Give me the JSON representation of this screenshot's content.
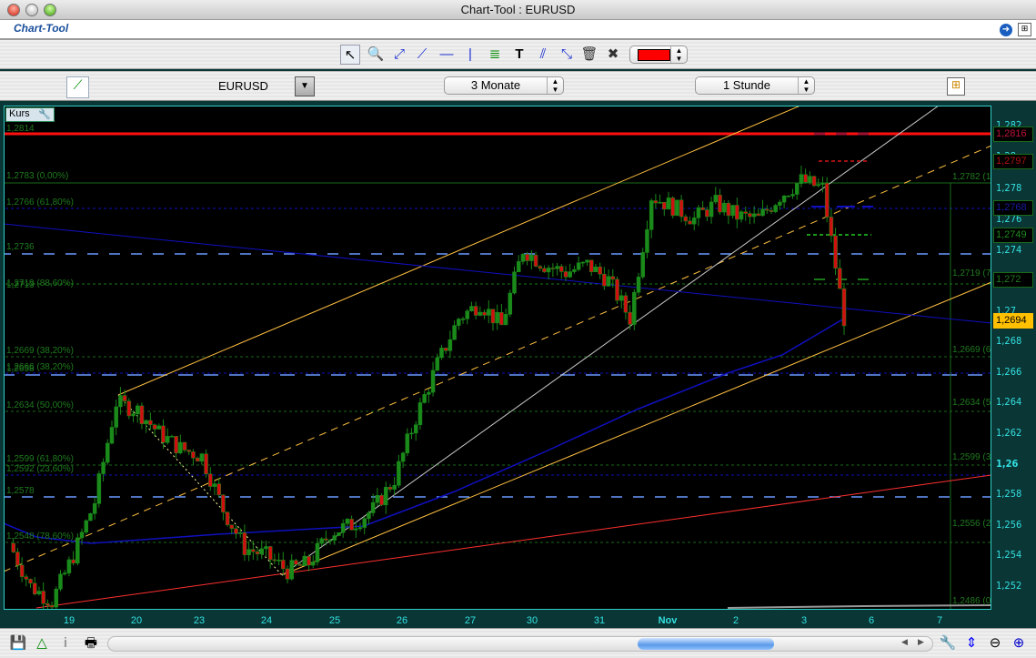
{
  "window": {
    "title": "Chart-Tool : EURUSD",
    "app_name": "Chart-Tool"
  },
  "toolbar": {
    "tools": [
      "pointer-icon",
      "zoom-icon",
      "segment-icon",
      "line-icon",
      "horizontal-line-icon",
      "vertical-line-icon",
      "fibonacci-icon",
      "text-icon",
      "parallel-lines-icon",
      "arrows-icon",
      "trash-icon",
      "tools-icon"
    ],
    "color": "#ff0000"
  },
  "selector": {
    "symbol": "EURUSD",
    "period": "3 Monate",
    "interval": "1 Stunde"
  },
  "chart": {
    "panel_label": "Kurs",
    "left_labels": [
      "1,2814",
      "1,2783 (0,00%)",
      "1,2766 (61,80%)",
      "1,2736",
      "1,2719 (88,60%)",
      "1,2713",
      "1,2669 (38,20%)",
      "1,2666 (38,20%)",
      "1,2658",
      "1,2634 (50,00%)",
      "1,2599 (61,80%)",
      "1,2592 (23,60%)",
      "1,2578",
      "1,2548 (78,60%)"
    ],
    "right_labels": [
      "1,2782 (1",
      "1,2719 (7",
      "1,2669 (6",
      "1,2634 (5",
      "1,2599 (3",
      "1,2556 (2",
      "1,2486 (0"
    ],
    "price_ticks": [
      "1,282",
      "1,28",
      "1,278",
      "1,276",
      "1,274",
      "1,27",
      "1,268",
      "1,266",
      "1,264",
      "1,262",
      "1,26",
      "1,258",
      "1,256",
      "1,254",
      "1,252"
    ],
    "price_boxes": [
      {
        "value": "1,2816",
        "color": "#c0103a"
      },
      {
        "value": "1,2797",
        "color": "#b01010"
      },
      {
        "value": "1,2768",
        "color": "#1a1aa0"
      },
      {
        "value": "1,2749",
        "color": "#1f8a1f"
      },
      {
        "value": "1,272",
        "color": "#1f7a1f"
      },
      {
        "value": "1,2694",
        "color": "#000000",
        "bg": "#ffc000"
      }
    ],
    "date_ticks": [
      "19",
      "20",
      "23",
      "24",
      "25",
      "26",
      "27",
      "30",
      "31",
      "Nov",
      "2",
      "3",
      "6",
      "7"
    ],
    "close_prices": [
      1.2548,
      1.252,
      1.251,
      1.254,
      1.2575,
      1.264,
      1.2635,
      1.262,
      1.261,
      1.2605,
      1.257,
      1.2545,
      1.254,
      1.253,
      1.2535,
      1.2555,
      1.256,
      1.257,
      1.259,
      1.263,
      1.2665,
      1.2695,
      1.2705,
      1.269,
      1.274,
      1.273,
      1.2725,
      1.273,
      1.272,
      1.2695,
      1.2775,
      1.2768,
      1.276,
      1.277,
      1.2762,
      1.276,
      1.2775,
      1.2785,
      1.278,
      1.2695
    ],
    "colors": {
      "up": "#1a8a1a",
      "down": "#d01010",
      "resistance": "#ff2020",
      "channel": "#ffc040",
      "ma": "#1010c0"
    }
  },
  "bottom_bar": {
    "left_icons": [
      "save-chart-icon",
      "indicators-icon",
      "info-icon",
      "print-icon"
    ],
    "right_icons": [
      "chart-settings-icon",
      "zoom-fit-icon",
      "zoom-out-icon",
      "zoom-in-icon"
    ]
  }
}
